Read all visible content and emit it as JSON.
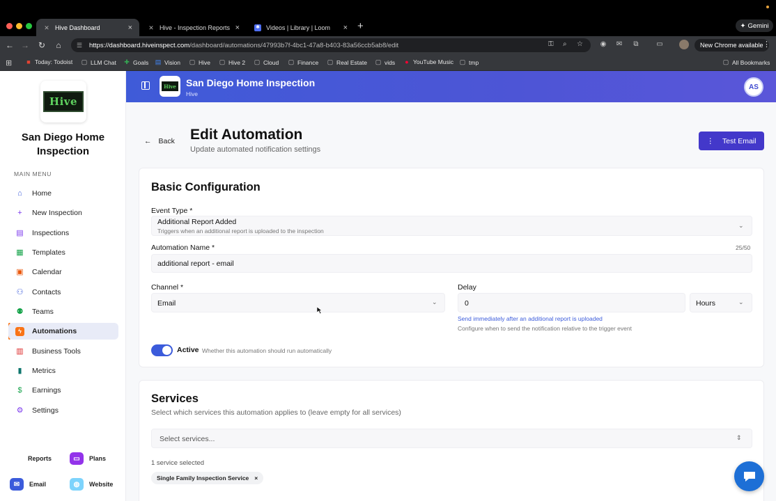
{
  "browser": {
    "tabs": [
      {
        "title": "Hive Dashboard",
        "icon": "x"
      },
      {
        "title": "Hive - Inspection Reports",
        "icon": "x"
      },
      {
        "title": "Videos | Library | Loom",
        "icon": "loom-icon"
      }
    ],
    "gemini_label": "Gemini",
    "url_host": "https://dashboard.hiveinspect.com",
    "url_path": "/dashboard/automations/47993b7f-4bc1-47a8-b403-83a56ccb5ab8/edit",
    "new_chrome": "New Chrome available",
    "bookmarks": [
      "Today: Todoist",
      "LLM Chat",
      "Goals",
      "Vision",
      "Hive",
      "Hive 2",
      "Cloud",
      "Finance",
      "Real Estate",
      "vids",
      "YouTube Music",
      "tmp"
    ],
    "all_bookmarks": "All Bookmarks"
  },
  "sidebar": {
    "company": "San Diego Home Inspection",
    "logo_text": "Hive",
    "menu_heading": "MAIN MENU",
    "items": [
      {
        "label": "Home",
        "icon": "home-icon"
      },
      {
        "label": "New Inspection",
        "icon": "plus-icon"
      },
      {
        "label": "Inspections",
        "icon": "clipboard-icon"
      },
      {
        "label": "Templates",
        "icon": "document-icon"
      },
      {
        "label": "Calendar",
        "icon": "calendar-icon"
      },
      {
        "label": "Contacts",
        "icon": "users-icon"
      },
      {
        "label": "Teams",
        "icon": "team-icon"
      },
      {
        "label": "Automations",
        "icon": "bolt-icon"
      },
      {
        "label": "Business Tools",
        "icon": "briefcase-icon"
      },
      {
        "label": "Metrics",
        "icon": "chart-icon"
      },
      {
        "label": "Earnings",
        "icon": "dollar-icon"
      },
      {
        "label": "Settings",
        "icon": "gear-icon"
      }
    ],
    "active_index": 7,
    "bottom": {
      "reports": "Reports",
      "plans": "Plans",
      "email": "Email",
      "website": "Website"
    }
  },
  "header": {
    "title": "San Diego Home Inspection",
    "subtitle": "Hive",
    "avatar": "AS"
  },
  "page": {
    "back_label": "Back",
    "title": "Edit Automation",
    "subtitle": "Update automated notification settings",
    "test_email_label": "Test Email"
  },
  "basic": {
    "title": "Basic Configuration",
    "event_type_label": "Event Type *",
    "event_type_value": "Additional Report Added",
    "event_type_hint": "Triggers when an additional report is uploaded to the inspection",
    "name_label": "Automation Name *",
    "name_value": "additional report - email",
    "name_counter": "25/50",
    "channel_label": "Channel *",
    "channel_value": "Email",
    "delay_label": "Delay",
    "delay_value": "0",
    "delay_unit": "Hours",
    "delay_link": "Send immediately after an additional report is uploaded",
    "delay_hint": "Configure when to send the notification relative to the trigger event",
    "active_label": "Active",
    "active_hint": "Whether this automation should run automatically",
    "active": true
  },
  "services": {
    "title": "Services",
    "subtitle": "Select which services this automation applies to (leave empty for all services)",
    "placeholder": "Select services...",
    "count_text": "1 service selected",
    "selected": [
      "Single Family Inspection Service"
    ]
  },
  "colors": {
    "accent": "#4338ca",
    "active_menu": "#f97316",
    "header_start": "#3f5bd8",
    "header_end": "#5a56d9"
  }
}
